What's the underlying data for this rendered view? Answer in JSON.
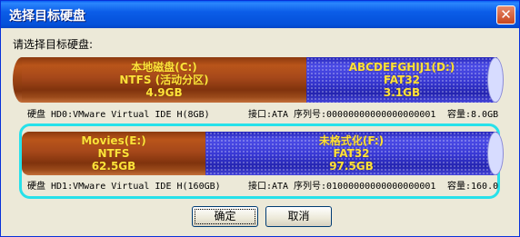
{
  "window": {
    "title": "选择目标硬盘",
    "close_glyph": "✕"
  },
  "prompt": "请选择目标硬盘:",
  "disks": [
    {
      "partitions": [
        {
          "lines": [
            "本地磁盘(C:)",
            "NTFS (活动分区)",
            "4.9GB"
          ],
          "kind": "primary"
        },
        {
          "lines": [
            "ABCDEFGHIJ1(D:)",
            "FAT32",
            "3.1GB"
          ],
          "kind": "fat"
        }
      ],
      "info": {
        "disk": "硬盘 HD0:VMware Virtual IDE H(8GB)",
        "port": "接口:ATA",
        "serial": "序列号:00000000000000000001",
        "capacity": "容量:8.0GB"
      },
      "selected": false
    },
    {
      "partitions": [
        {
          "lines": [
            "Movies(E:)",
            "NTFS",
            "62.5GB"
          ],
          "kind": "primary"
        },
        {
          "lines": [
            "未格式化(F:)",
            "FAT32",
            "97.5GB"
          ],
          "kind": "fat"
        }
      ],
      "info": {
        "disk": "硬盘 HD1:VMware Virtual IDE H(160GB)",
        "port": "接口:ATA",
        "serial": "序列号:01000000000000000001",
        "capacity": "容量:160.0"
      },
      "selected": true
    }
  ],
  "buttons": {
    "ok": "确定",
    "cancel": "取消"
  },
  "colors": {
    "primary_partition": "#a6481a",
    "fat_partition": "#3a3ad6",
    "label_text": "#ffe23a",
    "selection_border": "#27e1ea",
    "titlebar": "#0450d9"
  }
}
